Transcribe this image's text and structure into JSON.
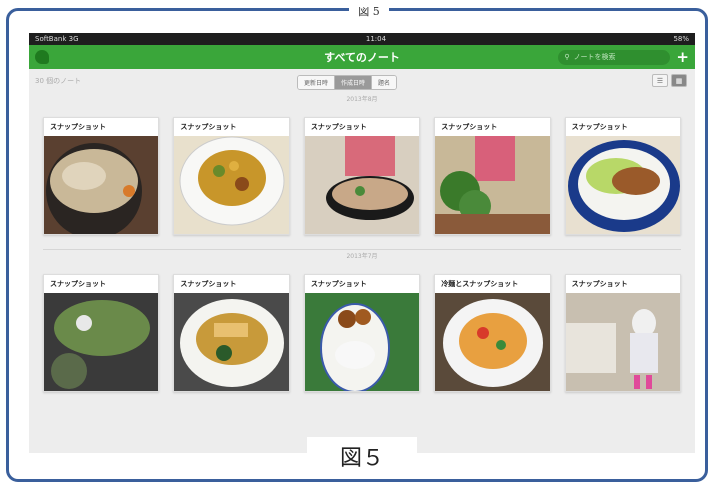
{
  "figure_label_top": "図 5",
  "caption": "図５",
  "status_bar": {
    "carrier": "SoftBank 3G",
    "time": "11:04",
    "battery": "58%"
  },
  "nav": {
    "title": "すべてのノート",
    "search_placeholder": "ノートを検索",
    "add_label": "+"
  },
  "toolbar": {
    "note_count": "30 個のノート",
    "segments": [
      "更新日時",
      "作成日時",
      "題名"
    ],
    "active_segment": 1
  },
  "sections": [
    {
      "month": "2013年8月",
      "notes": [
        {
          "title": "スナップショット",
          "photo": "noodle-bowl"
        },
        {
          "title": "スナップショット",
          "photo": "stir-fry-plate"
        },
        {
          "title": "スナップショット",
          "photo": "hotpot"
        },
        {
          "title": "スナップショット",
          "photo": "plant-table"
        },
        {
          "title": "スナップショット",
          "photo": "pork-salad-plate"
        }
      ]
    },
    {
      "month": "2013年7月",
      "notes": [
        {
          "title": "スナップショット",
          "photo": "salad-dish"
        },
        {
          "title": "スナップショット",
          "photo": "fish-plate"
        },
        {
          "title": "スナップショット",
          "photo": "curry-rice"
        },
        {
          "title": "冷麺とスナップショット",
          "photo": "pasta-plate"
        },
        {
          "title": "スナップショット",
          "photo": "child-room"
        }
      ]
    }
  ]
}
